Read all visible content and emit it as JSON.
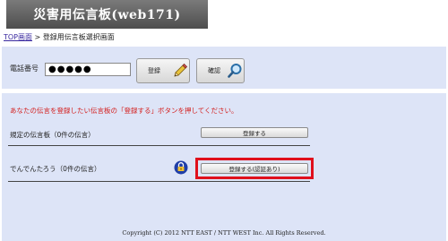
{
  "header": {
    "title": "災害用伝言板(web171)"
  },
  "breadcrumb": {
    "top_link": "TOP画面",
    "separator": " > ",
    "current": "登録用伝言板選択画面"
  },
  "phone": {
    "label": "電話番号",
    "value": "●●●●●",
    "register_label": "登録",
    "confirm_label": "確認"
  },
  "main": {
    "instruction": "あなたの伝言を登録したい伝言板の「登録する」ボタンを押してください。",
    "boards": [
      {
        "name": "規定の伝言板（0件の伝言）",
        "button_label": "登録する"
      },
      {
        "name": "でんでんたろう（0件の伝言）",
        "button_label": "登録する(認証あり)"
      }
    ]
  },
  "footer": {
    "copyright": "Copyright (C) 2012 NTT EAST / NTT WEST Inc. All Rights Reserved."
  },
  "colors": {
    "panel": "#dde4f7",
    "header": "#5f5f5f",
    "instruction": "#d4201f",
    "highlight": "#e0101c",
    "link": "#3a2aa0"
  },
  "icons": {
    "register": "pencil-icon",
    "confirm": "magnifier-icon",
    "auth": "lock-icon"
  }
}
